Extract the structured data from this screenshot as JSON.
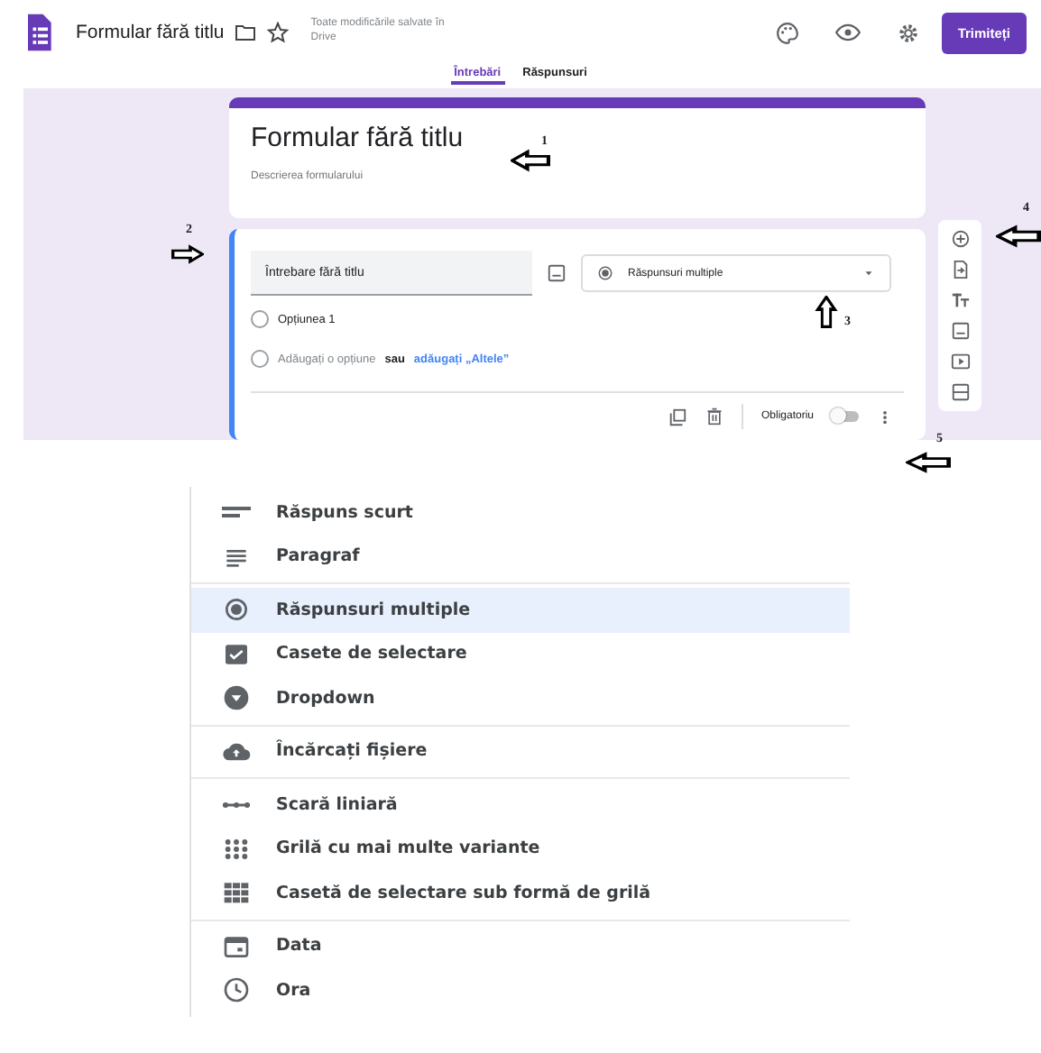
{
  "header": {
    "title": "Formular fără titlu",
    "save_status": "Toate modificările salvate în Drive",
    "send_button": "Trimiteți"
  },
  "tabs": [
    {
      "label": "Întrebări",
      "selected": true
    },
    {
      "label": "Răspunsuri",
      "selected": false
    }
  ],
  "form_header": {
    "title": "Formular fără titlu",
    "description": "Descrierea formularului"
  },
  "question": {
    "title": "Întrebare fără titlu",
    "type": "Răspunsuri multiple",
    "options": [
      {
        "label": "Opțiunea 1"
      }
    ],
    "add_option": "Adăugați o opțiune",
    "or": "sau",
    "add_other": "adăugați „Altele”",
    "required_label": "Obligatoriu",
    "required": false
  },
  "annotations": [
    {
      "number": "1",
      "kind": "left"
    },
    {
      "number": "2",
      "kind": "right"
    },
    {
      "number": "3",
      "kind": "up"
    },
    {
      "number": "4",
      "kind": "left"
    },
    {
      "number": "5",
      "kind": "left"
    }
  ],
  "type_menu": {
    "groups": [
      {
        "items": [
          {
            "kind": "short",
            "label": "Răspuns scurt",
            "selected": false
          },
          {
            "kind": "paragraph",
            "label": "Paragraf",
            "selected": false
          }
        ]
      },
      {
        "items": [
          {
            "kind": "radio",
            "label": "Răspunsuri multiple",
            "selected": true
          },
          {
            "kind": "checkbox",
            "label": "Casete de selectare",
            "selected": false
          },
          {
            "kind": "dropdown",
            "label": "Dropdown",
            "selected": false
          }
        ]
      },
      {
        "items": [
          {
            "kind": "upload",
            "label": "Încărcați fișiere",
            "selected": false
          }
        ]
      },
      {
        "items": [
          {
            "kind": "scale",
            "label": "Scară liniară",
            "selected": false
          },
          {
            "kind": "grid",
            "label": "Grilă cu mai multe variante",
            "selected": false
          },
          {
            "kind": "checkgrid",
            "label": "Casetă de selectare sub formă de grilă",
            "selected": false
          }
        ]
      },
      {
        "items": [
          {
            "kind": "date",
            "label": "Data",
            "selected": false
          },
          {
            "kind": "time",
            "label": "Ora",
            "selected": false
          }
        ]
      }
    ]
  }
}
